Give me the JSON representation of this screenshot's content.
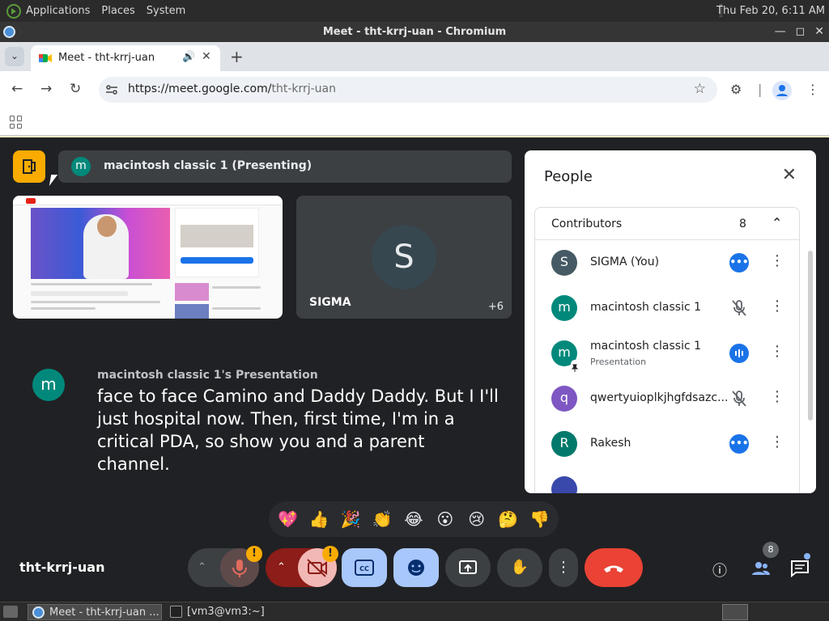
{
  "os": {
    "menus": [
      "Applications",
      "Places",
      "System"
    ],
    "clock": "Thu Feb 20,  6:11 AM"
  },
  "window": {
    "title": "Meet - tht-krrj-uan - Chromium"
  },
  "browser": {
    "tab_title": "Meet - tht-krrj-uan",
    "url_host": "https://meet.google.com/",
    "url_path": "tht-krrj-uan"
  },
  "meet": {
    "presenting_avatar": "m",
    "presenting_label": "macintosh classic 1 (Presenting)",
    "tile_name": "SIGMA",
    "tile_initial": "S",
    "tile_more": "+6",
    "caption": {
      "avatar": "m",
      "speaker": "macintosh classic 1's Presentation",
      "text": "face to face Camino and Daddy Daddy. But I I'll just hospital now. Then, first time, I'm in a critical PDA, so show you and a parent channel."
    },
    "meeting_code": "tht-krrj-uan",
    "reactions": [
      "💖",
      "👍",
      "🎉",
      "👏",
      "😂",
      "😮",
      "😢",
      "🤔",
      "👎"
    ],
    "people_badge": "8"
  },
  "people": {
    "title": "People",
    "section_label": "Contributors",
    "section_count": "8",
    "participants": [
      {
        "initial": "S",
        "name": "SIGMA (You)",
        "color": "#455a64",
        "status": "more"
      },
      {
        "initial": "m",
        "name": "macintosh classic 1",
        "color": "#00897b",
        "status": "muted"
      },
      {
        "initial": "m",
        "name": "macintosh classic 1",
        "sub": "Presentation",
        "color": "#00897b",
        "status": "speaking"
      },
      {
        "initial": "q",
        "name": "qwertyuioplkjhgfdsazc...",
        "color": "#7e57c2",
        "status": "muted"
      },
      {
        "initial": "R",
        "name": "Rakesh",
        "color": "#00796b",
        "status": "more"
      }
    ]
  },
  "taskbar": {
    "items": [
      "Meet - tht-krrj-uan ...",
      "[vm3@vm3:~]"
    ]
  }
}
